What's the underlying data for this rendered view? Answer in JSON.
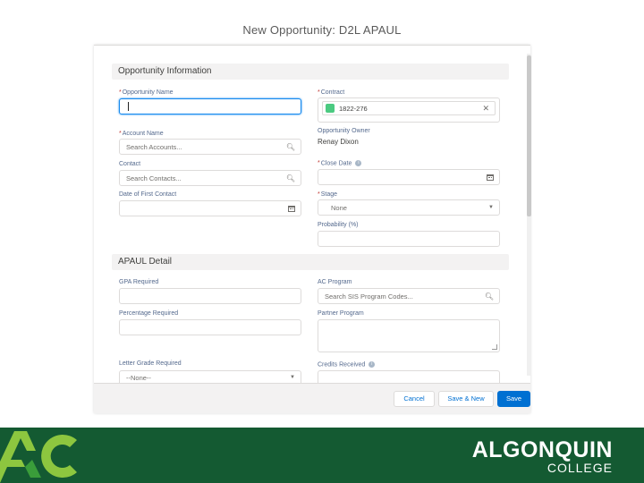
{
  "window": {
    "title": "New Opportunity: D2L APAUL"
  },
  "sections": {
    "opportunity_info": {
      "title": "Opportunity Information"
    },
    "apaul_detail": {
      "title": "APAUL Detail"
    }
  },
  "fields": {
    "opportunity_name": {
      "label": "Opportunity Name",
      "value": ""
    },
    "account_name": {
      "label": "Account Name",
      "placeholder": "Search Accounts..."
    },
    "contact": {
      "label": "Contact",
      "placeholder": "Search Contacts..."
    },
    "date_first_contact": {
      "label": "Date of First Contact",
      "value": ""
    },
    "contract": {
      "label": "Contract",
      "value": "1822-276"
    },
    "opportunity_owner": {
      "label": "Opportunity Owner",
      "value": "Renay Dixon"
    },
    "close_date": {
      "label": "Close Date",
      "value": ""
    },
    "stage": {
      "label": "Stage",
      "value": "None"
    },
    "probability": {
      "label": "Probability (%)",
      "value": ""
    },
    "gpa_required": {
      "label": "GPA Required",
      "value": ""
    },
    "ac_program": {
      "label": "AC Program",
      "placeholder": "Search SIS Program Codes..."
    },
    "percentage_required": {
      "label": "Percentage Required",
      "value": ""
    },
    "partner_program": {
      "label": "Partner Program",
      "value": ""
    },
    "letter_grade": {
      "label": "Letter Grade Required",
      "value": "--None--"
    },
    "credits_received": {
      "label": "Credits Received",
      "value": ""
    }
  },
  "required_marker": "*",
  "footer": {
    "cancel_label": "Cancel",
    "save_new_label": "Save & New",
    "save_label": "Save"
  },
  "branding": {
    "wordmark_main": "ALGONQUIN",
    "wordmark_sub": "COLLEGE",
    "colors": {
      "bar": "#145a32",
      "logo_light": "#8dc63f",
      "logo_mid": "#3a9d3a"
    }
  },
  "colors": {
    "brand_button": "#0070d2",
    "focus": "#1589ee",
    "required": "#c23934"
  },
  "icons": {
    "search": "search-icon",
    "calendar": "calendar-icon",
    "close": "close-icon",
    "chevron": "chevron-down-icon",
    "info": "info-icon"
  }
}
